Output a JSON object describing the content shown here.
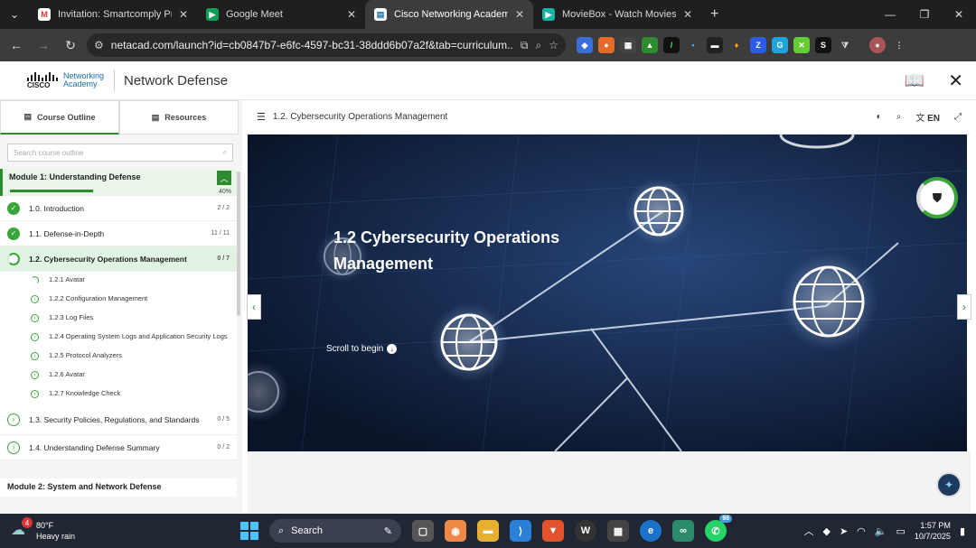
{
  "browser": {
    "tabs": [
      {
        "title": "Invitation: Smartcomply Produc",
        "icon": "gmail-icon",
        "active": false
      },
      {
        "title": "Google Meet",
        "icon": "meet-icon",
        "active": false
      },
      {
        "title": "Cisco Networking Academy: Ne",
        "icon": "netacad-icon",
        "active": true
      },
      {
        "title": "MovieBox - Watch Movies Free",
        "icon": "moviebox-icon",
        "active": false
      }
    ],
    "url": "netacad.com/launch?id=cb0847b7-e6fc-4597-bc31-38ddd6b07a2f&tab=curriculum..."
  },
  "header": {
    "logo_brand": "CISCO",
    "logo_line1": "Networking",
    "logo_line2": "Academy",
    "course_title": "Network Defense"
  },
  "sidebar": {
    "tab_outline": "Course Outline",
    "tab_resources": "Resources",
    "search_placeholder": "Search course outline",
    "module1": {
      "title": "Module 1: Understanding Defense",
      "progress_pct": "40%",
      "progress": 0.4
    },
    "items": [
      {
        "label": "1.0. Introduction",
        "count": "2 / 2",
        "state": "done"
      },
      {
        "label": "1.1. Defense-in-Depth",
        "count": "11 / 11",
        "state": "done"
      },
      {
        "label": "1.2. Cybersecurity Operations Management",
        "count": "0 / 7",
        "state": "current"
      }
    ],
    "subitems": [
      {
        "label": "1.2.1 Avatar"
      },
      {
        "label": "1.2.2 Configuration Management"
      },
      {
        "label": "1.2.3 Log Files"
      },
      {
        "label": "1.2.4 Operating System Logs and Application Security Logs"
      },
      {
        "label": "1.2.5 Protocol Analyzers"
      },
      {
        "label": "1.2.6 Avatar"
      },
      {
        "label": "1.2.7 Knowledge Check"
      }
    ],
    "items2": [
      {
        "label": "1.3. Security Policies, Regulations, and Standards",
        "count": "0 / 5"
      },
      {
        "label": "1.4. Understanding Defense Summary",
        "count": "0 / 2"
      }
    ],
    "module2_title": "Module 2: System and Network Defense"
  },
  "main": {
    "breadcrumb": "1.2. Cybersecurity Operations Management",
    "lang": "EN",
    "hero_title": "1.2 Cybersecurity Operations Management",
    "scroll_label": "Scroll to begin"
  },
  "taskbar": {
    "temp": "80°F",
    "weather": "Heavy rain",
    "weather_badge": "4",
    "search": "Search",
    "whatsapp_badge": "98",
    "time": "1:57 PM",
    "date": "10/7/2025"
  },
  "colors": {
    "accent": "#2e8b2e",
    "hero_bg": "#0d1a33",
    "taskbar": "#202632"
  }
}
